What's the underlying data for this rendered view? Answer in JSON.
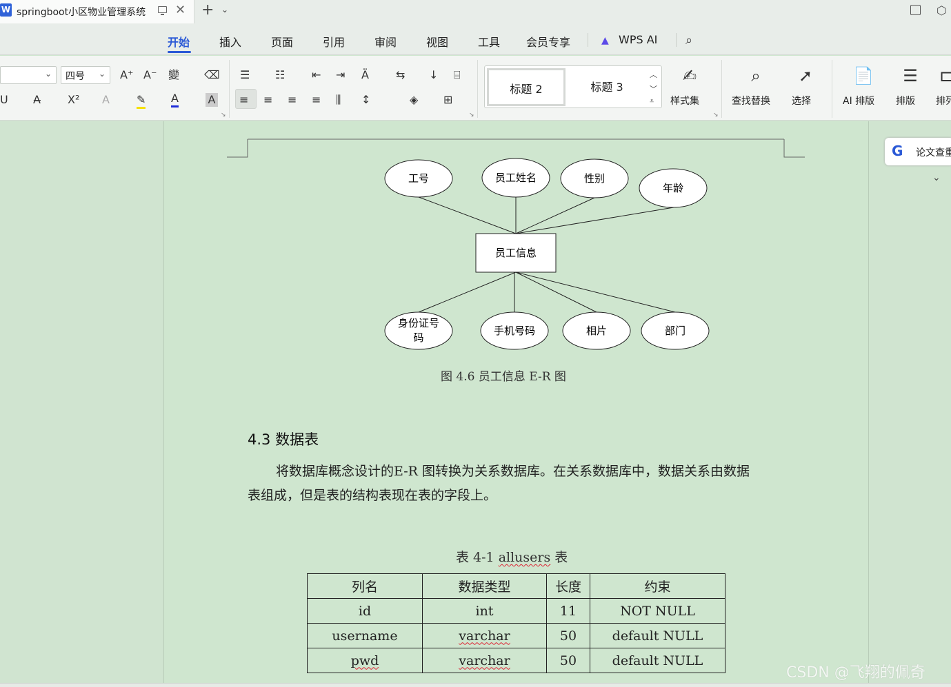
{
  "window": {
    "tab_title": "springboot小区物业管理系统",
    "logo_letter": "W",
    "new_tab": "+",
    "tab_dropdown": "⌄",
    "close": "✕"
  },
  "menu": {
    "items": [
      "开始",
      "插入",
      "页面",
      "引用",
      "审阅",
      "视图",
      "工具",
      "会员专享"
    ],
    "wps_ai": "WPS AI",
    "active_color": "#2a59d6"
  },
  "ribbon": {
    "font_size": "四号",
    "styles": [
      "标题 2",
      "标题 3"
    ],
    "style_set_label": "样式集",
    "find_replace_label": "查找替换",
    "select_label": "选择",
    "ai_layout_label": "AI 排版",
    "layout_label": "排版",
    "layout2_label": "排列"
  },
  "sidepanel": {
    "essay_check": "论文查重"
  },
  "diagram": {
    "entity": "员工信息",
    "attributes_top": [
      "工号",
      "员工姓名",
      "性别",
      "年龄"
    ],
    "attributes_bottom": [
      "身份证号",
      "码",
      "手机号码",
      "相片",
      "部门"
    ],
    "caption": "图 4.6 员工信息 E-R 图"
  },
  "section": {
    "heading": "4.3  数据表",
    "para_line1": "将数据库概念设计的E-R 图转换为关系数据库。在关系数据库中，数据关系由数据",
    "para_line2": "表组成，但是表的结构表现在表的字段上。",
    "table_caption_prefix": "表 4-1 ",
    "table_caption_name": "allusers",
    "table_caption_suffix": " 表"
  },
  "table": {
    "headers": [
      "列名",
      "数据类型",
      "长度",
      "约束"
    ],
    "rows": [
      [
        "id",
        "int",
        "11",
        "NOT NULL"
      ],
      [
        "username",
        "varchar",
        "50",
        "default  NULL"
      ],
      [
        "pwd",
        "varchar",
        "50",
        "default  NULL"
      ]
    ]
  },
  "watermark": "CSDN @飞翔的佩奇"
}
